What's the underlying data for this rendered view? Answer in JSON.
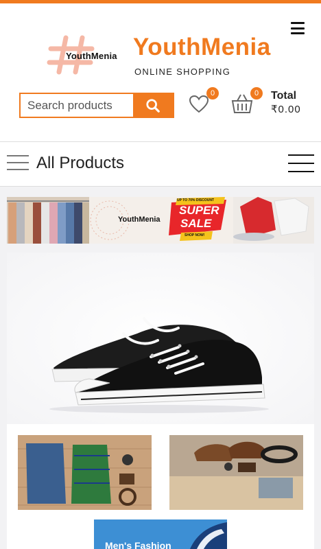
{
  "header": {
    "brand_name": "YouthMenia",
    "brand_tagline": "ONLINE SHOPPING",
    "logo_text": "YouthMenia",
    "menu_icon": "hamburger-icon"
  },
  "search": {
    "placeholder": "Search products",
    "button_icon": "search-icon"
  },
  "wishlist": {
    "icon": "heart-icon",
    "count": "0"
  },
  "cart": {
    "icon": "basket-icon",
    "count": "0",
    "total_label": "Total",
    "total_value": "₹0.00"
  },
  "category_bar": {
    "title": "All Products",
    "icon": "list-icon",
    "toggle_icon": "hamburger-icon"
  },
  "banner": {
    "logo_text": "YouthMenia",
    "sale_line1": "SUPER",
    "sale_line2": "SALE",
    "sale_top": "UP TO 70% DISCOUNT",
    "sale_bottom": "SHOP NOW!"
  },
  "promo": {
    "title": "Men's Fashion"
  },
  "colors": {
    "accent": "#f07a1f",
    "promo_blue": "#2f7fc6"
  }
}
